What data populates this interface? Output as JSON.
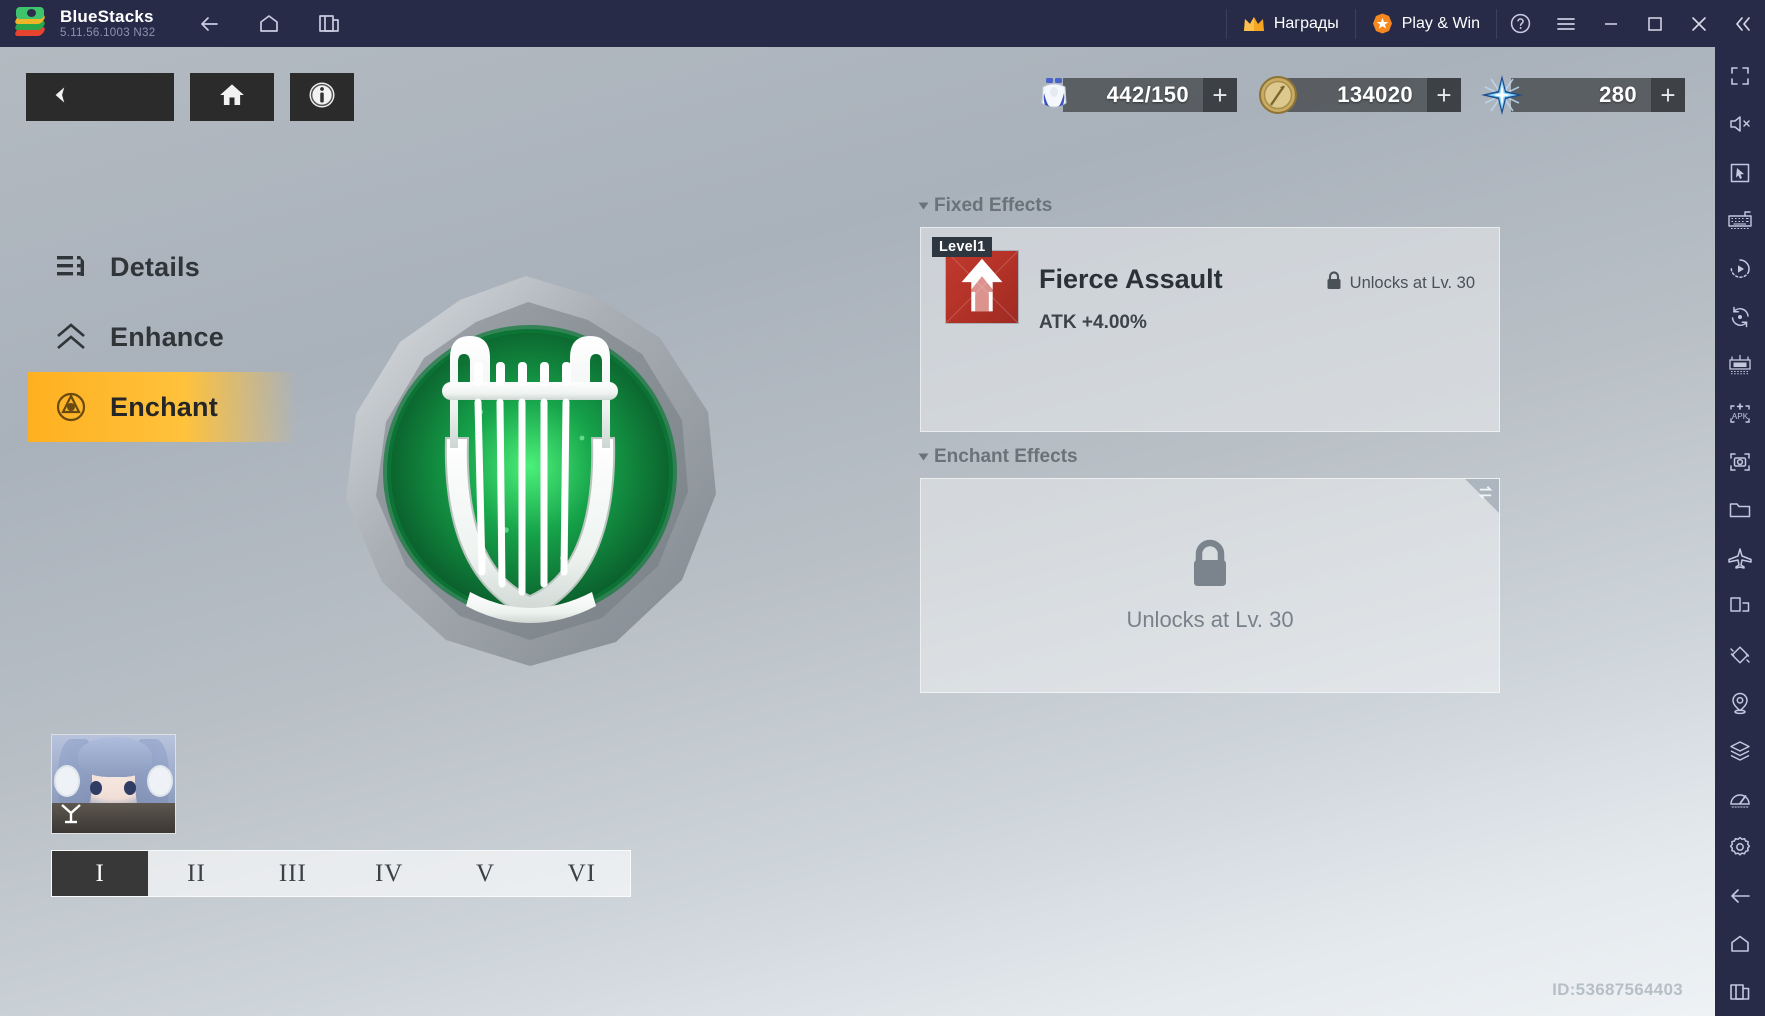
{
  "titlebar": {
    "app_name": "BlueStacks",
    "version": "5.11.56.1003  N32",
    "nav": [
      {
        "name": "back-icon",
        "label": "Back"
      },
      {
        "name": "home-icon",
        "label": "Home"
      },
      {
        "name": "multi-instance-icon",
        "label": "Multi-instance"
      }
    ],
    "rewards_label": "Награды",
    "play_win_label": "Play & Win",
    "help_label": "?",
    "menu_label": "Menu",
    "minimize_label": "Minimize",
    "maximize_label": "Maximize",
    "close_label": "Close",
    "collapse_label": "Collapse"
  },
  "right_toolbar": {
    "items": [
      {
        "name": "fullscreen-icon",
        "label": "Full screen"
      },
      {
        "name": "mute-icon",
        "label": "Mute"
      },
      {
        "name": "cursor-icon",
        "label": "Pointer"
      },
      {
        "name": "keyboard-controls-icon",
        "label": "Game controls"
      },
      {
        "name": "macro-record-icon",
        "label": "Macro recorder"
      },
      {
        "name": "rotate-icon",
        "label": "Rotate"
      },
      {
        "name": "multi-instance-manager-icon",
        "label": "Multi-instance manager"
      },
      {
        "name": "install-apk-icon",
        "label": "Install APK",
        "text": "APK"
      },
      {
        "name": "screenshot-icon",
        "label": "Screenshot"
      },
      {
        "name": "media-folder-icon",
        "label": "Media manager"
      },
      {
        "name": "airplane-icon",
        "label": "Eco mode"
      },
      {
        "name": "screen-split-icon",
        "label": "Real-time translation"
      },
      {
        "name": "shake-icon",
        "label": "Shake"
      },
      {
        "name": "location-icon",
        "label": "Location"
      },
      {
        "name": "layers-icon",
        "label": "Layers"
      },
      {
        "name": "performance-icon",
        "label": "Performance"
      },
      {
        "name": "settings-gear-icon",
        "label": "Settings"
      },
      {
        "name": "android-back-icon",
        "label": "Back"
      },
      {
        "name": "android-home-icon",
        "label": "Home"
      },
      {
        "name": "android-recents-icon",
        "label": "Recent apps"
      }
    ]
  },
  "game": {
    "top_buttons": [
      {
        "name": "game-back-button",
        "icon": "chevron-left-icon"
      },
      {
        "name": "game-home-button",
        "icon": "home-icon"
      },
      {
        "name": "game-info-button",
        "icon": "info-icon"
      }
    ],
    "currencies": [
      {
        "icon": "stamina-icon",
        "value": "442/150",
        "plus": "+"
      },
      {
        "icon": "gold-coin-icon",
        "value": "134020",
        "plus": "+"
      },
      {
        "icon": "star-crystal-icon",
        "value": "280",
        "plus": "+"
      }
    ],
    "menu": [
      {
        "label": "Details",
        "icon": "details-list-icon",
        "active": false
      },
      {
        "label": "Enhance",
        "icon": "chevrons-up-icon",
        "active": false
      },
      {
        "label": "Enchant",
        "icon": "enchant-icon",
        "active": true
      }
    ],
    "emblem": {
      "name": "lyre-harp-emblem",
      "label": "Lyre emblem"
    },
    "fixed_effects": {
      "section_title": "Fixed Effects",
      "level_badge": "Level1",
      "effect_name": "Fierce Assault",
      "effect_stat": "ATK +4.00%",
      "lock_text": "Unlocks at Lv. 30"
    },
    "enchant_effects": {
      "section_title": "Enchant Effects",
      "lock_text": "Unlocks at Lv. 30",
      "swap_icon": "swap-icon"
    },
    "character_thumb": {
      "name": "character-portrait",
      "label": "Character"
    },
    "roman_tabs": [
      {
        "label": "I",
        "active": true
      },
      {
        "label": "II",
        "active": false
      },
      {
        "label": "III",
        "active": false
      },
      {
        "label": "IV",
        "active": false
      },
      {
        "label": "V",
        "active": false
      },
      {
        "label": "VI",
        "active": false
      }
    ],
    "id_text": "ID:53687564403"
  },
  "colors": {
    "titlebar_bg": "#272b48",
    "accent_orange": "#ffb020",
    "dark_button": "#2b2b2b",
    "panel_text": "#2b3237"
  }
}
